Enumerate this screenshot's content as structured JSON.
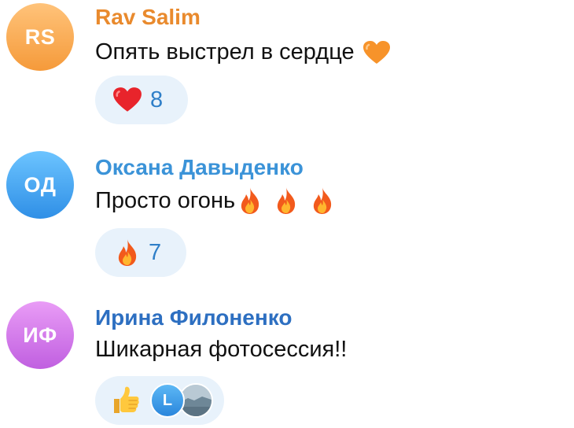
{
  "comments": [
    {
      "initials": "RS",
      "author": "Rav Salim",
      "text": "Опять выстрел в сердце",
      "text_emojis": [
        "orange-heart"
      ],
      "reaction": {
        "emoji": "red-heart",
        "count": "8"
      },
      "colors": {
        "avatar": "#f5a34a",
        "author": "#e98a2d"
      }
    },
    {
      "initials": "ОД",
      "author": "Оксана Давыденко",
      "text": "Просто огонь",
      "text_emojis": [
        "fire",
        "fire",
        "fire"
      ],
      "reaction": {
        "emoji": "fire",
        "count": "7"
      },
      "colors": {
        "avatar": "#3a9ae8",
        "author": "#3b93d8"
      }
    },
    {
      "initials": "ИФ",
      "author": "Ирина Филоненко",
      "text": "Шикарная фотосессия!!",
      "text_emojis": [],
      "reaction": {
        "emoji": "thumbs-up",
        "reactor_initial": "L"
      },
      "colors": {
        "avatar": "#cf74ea",
        "author": "#2d6fc1"
      }
    }
  ],
  "colors": {
    "reaction_pill_bg": "#e8f2fb",
    "reaction_count": "#2f7fc8"
  }
}
